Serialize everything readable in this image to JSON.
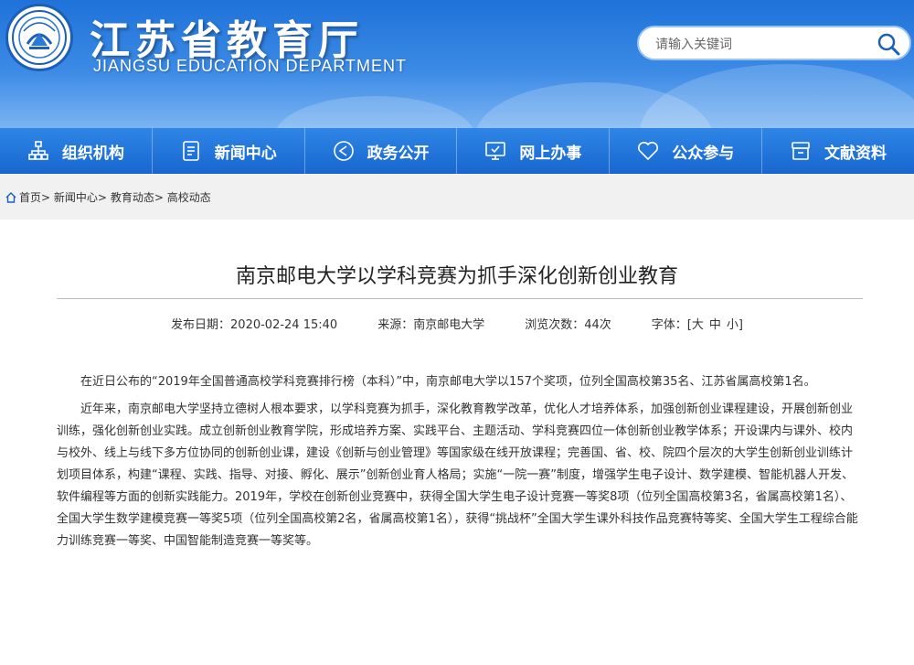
{
  "header": {
    "title": "江苏省教育厅",
    "subtitle": "JIANGSU EDUCATION DEPARTMENT",
    "logo_icon": "department-emblem-icon"
  },
  "search": {
    "placeholder": "请输入关键词",
    "icon": "search-icon"
  },
  "nav": {
    "items": [
      {
        "label": "组织机构",
        "icon": "org-chart-icon"
      },
      {
        "label": "新闻中心",
        "icon": "news-document-icon"
      },
      {
        "label": "政务公开",
        "icon": "send-icon"
      },
      {
        "label": "网上办事",
        "icon": "monitor-icon"
      },
      {
        "label": "公众参与",
        "icon": "heart-icon"
      },
      {
        "label": "文献资料",
        "icon": "archive-icon"
      }
    ]
  },
  "breadcrumb": {
    "items": [
      "首页",
      "新闻中心",
      "教育动态",
      "高校动态"
    ],
    "separator": ">"
  },
  "article": {
    "title": "南京邮电大学以学科竞赛为抓手深化创新创业教育",
    "meta": {
      "date_label": "发布日期：2020-02-24 15:40",
      "source_label": "来源：南京邮电大学",
      "views_label": "浏览次数：44次",
      "font_label": "字体：[",
      "font_large": "大",
      "font_medium": "中",
      "font_small": "小",
      "font_close": "]"
    },
    "paragraphs": [
      "在近日公布的“2019年全国普通高校学科竞赛排行榜（本科）”中，南京邮电大学以157个奖项，位列全国高校第35名、江苏省属高校第1名。",
      "近年来，南京邮电大学坚持立德树人根本要求，以学科竞赛为抓手，深化教育教学改革，优化人才培养体系，加强创新创业课程建设，开展创新创业训练，强化创新创业实践。成立创新创业教育学院，形成培养方案、实践平台、主题活动、学科竞赛四位一体创新创业教学体系；开设课内与课外、校内与校外、线上与线下多方位协同的创新创业课，建设《创新与创业管理》等国家级在线开放课程；完善国、省、校、院四个层次的大学生创新创业训练计划项目体系，构建“课程、实践、指导、对接、孵化、展示”创新创业育人格局；实施“一院一赛”制度，增强学生电子设计、数学建模、智能机器人开发、软件编程等方面的创新实践能力。2019年，学校在创新创业竞赛中，获得全国大学生电子设计竞赛一等奖8项（位列全国高校第3名，省属高校第1名）、全国大学生数学建模竞赛一等奖5项（位列全国高校第2名，省属高校第1名），获得“挑战杯”全国大学生课外科技作品竞赛特等奖、全国大学生工程综合能力训练竞赛一等奖、中国智能制造竞赛一等奖等。"
    ]
  },
  "colors": {
    "header_blue": "#1f72d8",
    "nav_blue": "#1766cf",
    "breadcrumb_bg": "#f1f1f1"
  }
}
